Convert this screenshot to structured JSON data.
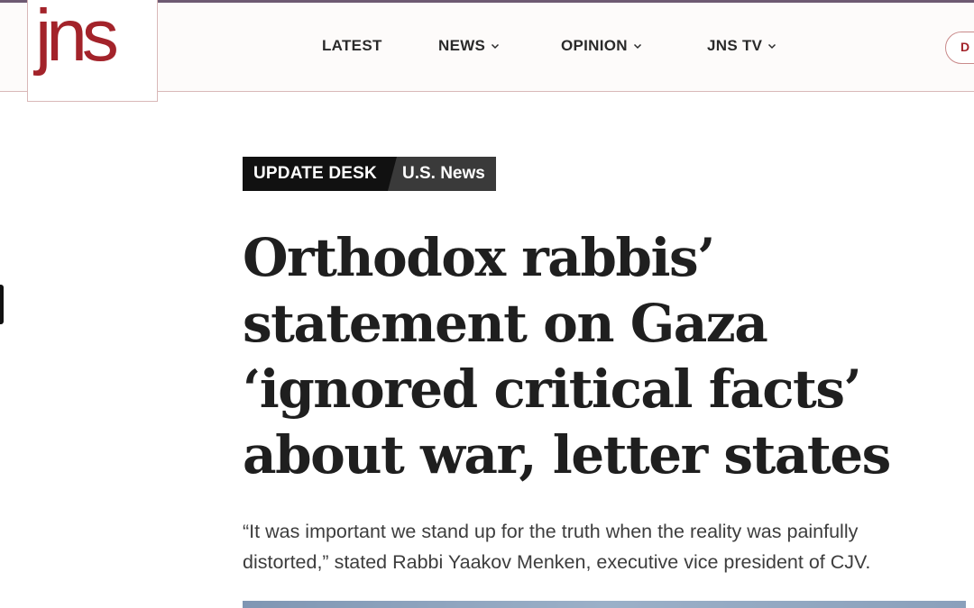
{
  "header": {
    "logo": "jns",
    "nav": [
      {
        "label": "LATEST",
        "has_dropdown": false
      },
      {
        "label": "NEWS",
        "has_dropdown": true
      },
      {
        "label": "OPINION",
        "has_dropdown": true
      },
      {
        "label": "JNS TV",
        "has_dropdown": true
      }
    ],
    "donate_label": "D",
    "icons": {
      "dropdown": "chevron-down-icon"
    }
  },
  "article": {
    "section_label": "UPDATE DESK",
    "category_label": "U.S. News",
    "headline_lines": [
      "Orthodox rabbis’",
      "statement on Gaza",
      "‘ignored critical facts’",
      "about war, letter states"
    ],
    "dek_lines": [
      "“It was important we stand up for the truth when the reality was painfully",
      "distorted,” stated Rabbi Yaakov Menken, executive vice president of CJV."
    ]
  },
  "colors": {
    "brand": "#a3232a",
    "badge_dark": "#111111",
    "badge_gray": "#3a3a3a",
    "text": "#1f1f1f"
  }
}
